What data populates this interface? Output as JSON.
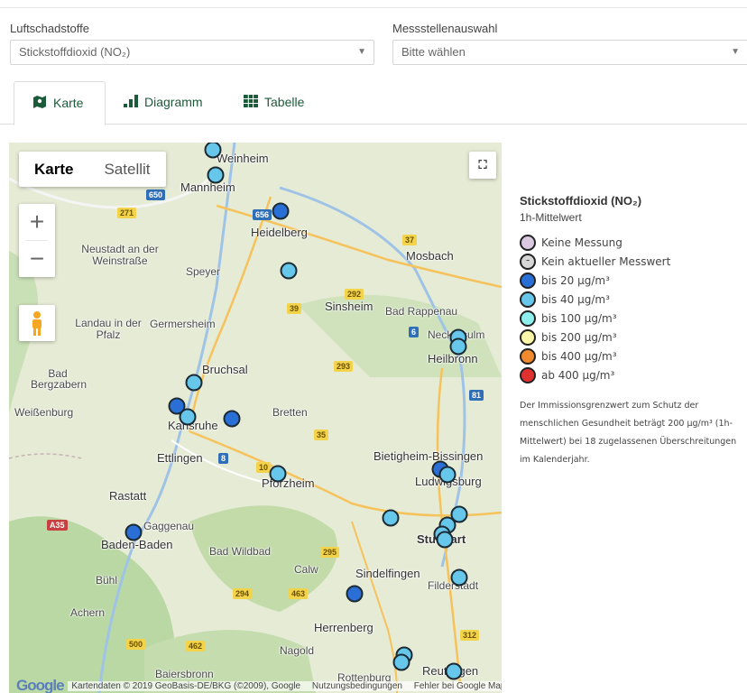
{
  "filters": {
    "pollutant_label": "Luftschadstoffe",
    "pollutant_value": "Stickstoffdioxid (NO₂)",
    "station_label": "Messstellenauswahl",
    "station_value": "Bitte wählen"
  },
  "tabs": [
    {
      "label": "Karte",
      "icon": "map-icon",
      "active": true
    },
    {
      "label": "Diagramm",
      "icon": "bar-chart-icon",
      "active": false
    },
    {
      "label": "Tabelle",
      "icon": "table-icon",
      "active": false
    }
  ],
  "map": {
    "type_controls": {
      "map": "Karte",
      "satellite": "Satellit"
    },
    "zoom_in": "+",
    "zoom_out": "−",
    "fullscreen_glyph": "⛶",
    "attribution": {
      "logo": "Google",
      "data": "Kartendaten © 2019 GeoBasis-DE/BKG (©2009), Google",
      "terms": "Nutzungsbedingungen",
      "report": "Fehler bei Google Maps melden"
    },
    "places": [
      "Weinheim",
      "Mannheim",
      "Heidelberg",
      "Neustadt an der Weinstraße",
      "Speyer",
      "Mosbach",
      "Sinsheim",
      "Bad Rappenau",
      "Landau in der Pfalz",
      "Germersheim",
      "Neckarsulm",
      "Heilbronn",
      "Bruchsal",
      "Bad Bergzabern",
      "Weißenburg",
      "Karlsruhe",
      "Bretten",
      "Ettlingen",
      "Bietigheim-Bissingen",
      "Pforzheim",
      "Ludwigsburg",
      "Rastatt",
      "Gaggenau",
      "Baden-Baden",
      "Stuttgart",
      "Bad Wildbad",
      "Calw",
      "Sindelfingen",
      "Bühl",
      "Filderstadt",
      "Achern",
      "Herrenberg",
      "Nagold",
      "Baiersbronn",
      "Rottenburg",
      "Reutlingen"
    ],
    "stations": [
      {
        "category": "bis 40 µg/m3"
      },
      {
        "category": "bis 40 µg/m3"
      },
      {
        "category": "bis 20 µg/m3"
      },
      {
        "category": "bis 40 µg/m3"
      },
      {
        "category": "bis 40 µg/m3"
      },
      {
        "category": "bis 40 µg/m3"
      },
      {
        "category": "bis 40 µg/m3"
      },
      {
        "category": "bis 20 µg/m3"
      },
      {
        "category": "bis 40 µg/m3"
      },
      {
        "category": "bis 20 µg/m3"
      },
      {
        "category": "bis 40 µg/m3"
      },
      {
        "category": "bis 20 µg/m3"
      },
      {
        "category": "bis 40 µg/m3"
      },
      {
        "category": "bis 40 µg/m3"
      },
      {
        "category": "bis 20 µg/m3"
      },
      {
        "category": "bis 40 µg/m3"
      },
      {
        "category": "bis 40 µg/m3"
      },
      {
        "category": "bis 40 µg/m3"
      },
      {
        "category": "bis 40 µg/m3"
      },
      {
        "category": "bis 40 µg/m3"
      },
      {
        "category": "bis 20 µg/m3"
      },
      {
        "category": "bis 40 µg/m3"
      },
      {
        "category": "bis 40 µg/m3"
      },
      {
        "category": "bis 40 µg/m3"
      }
    ]
  },
  "legend": {
    "title": "Stickstoffdioxid (NO₂)",
    "subtitle": "1h-Mittelwert",
    "items": [
      {
        "label": "Keine Messung",
        "color": "#d9c8e0"
      },
      {
        "label": "Kein aktueller Messwert",
        "color": "#d6d6d6"
      },
      {
        "label": "bis 20 µg/m³",
        "color": "#2a6fd6"
      },
      {
        "label": "bis 40 µg/m³",
        "color": "#67c7ea"
      },
      {
        "label": "bis 100 µg/m³",
        "color": "#8fefef"
      },
      {
        "label": "bis 200 µg/m³",
        "color": "#fbf6a8"
      },
      {
        "label": "bis 400 µg/m³",
        "color": "#f08a2e"
      },
      {
        "label": "ab 400 µg/m³",
        "color": "#e03030"
      }
    ],
    "note": "Der Immissionsgrenzwert zum Schutz der menschlichen Gesundheit beträgt 200 µg/m³ (1h-Mittelwert) bei 18 zugelassenen Überschreitungen im Kalenderjahr."
  }
}
